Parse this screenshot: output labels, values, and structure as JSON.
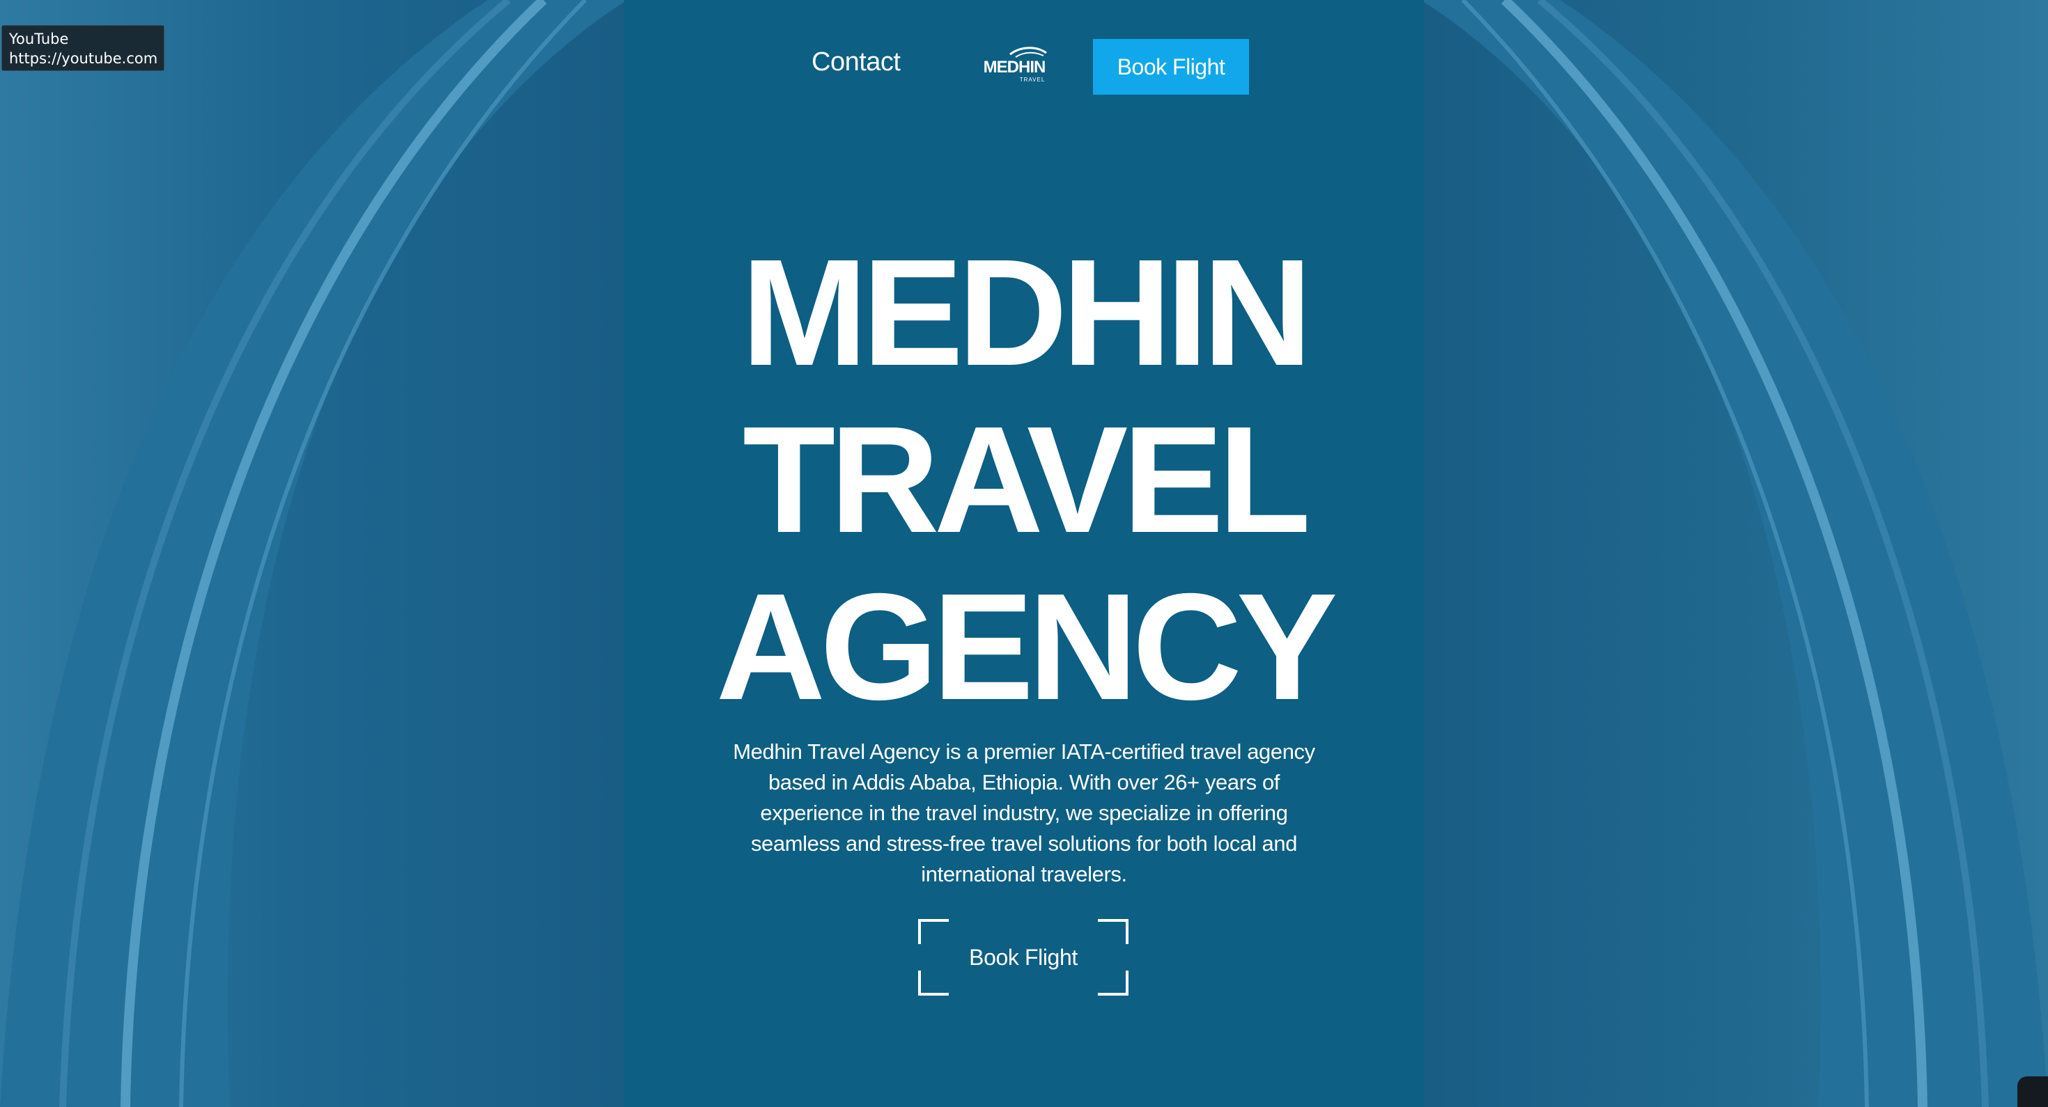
{
  "tooltip": {
    "title": "YouTube",
    "url": "https://youtube.com"
  },
  "nav": {
    "contact_label": "Contact",
    "logo_text": "MEDHIN",
    "logo_subtext": "TRAVEL",
    "book_label": "Book Flight"
  },
  "hero": {
    "title_line1": "MEDHIN",
    "title_line2": "TRAVEL",
    "title_line3": "AGENCY",
    "description": "Medhin Travel Agency is a premier IATA-certified travel agency based in Addis Ababa, Ethiopia. With over 26+ years of experience in the travel industry, we specialize in offering seamless and stress-free travel solutions for both local and international travelers.",
    "cta_label": "Book Flight"
  },
  "colors": {
    "background": "#1c5b80",
    "center_panel": "#0d5f83",
    "accent_button": "#10a8ea",
    "text": "#ffffff"
  }
}
